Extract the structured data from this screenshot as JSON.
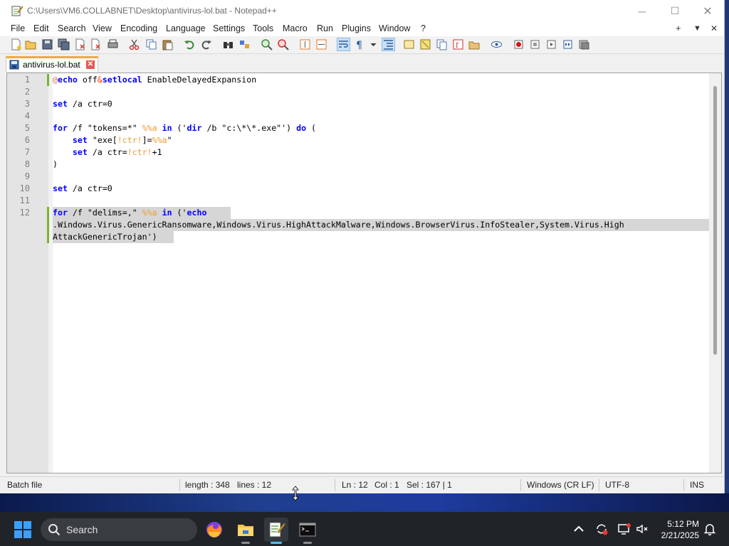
{
  "window": {
    "title": "C:\\Users\\VM6.COLLABNET\\Desktop\\antivirus-lol.bat - Notepad++",
    "minimize_icon": "minimize-icon",
    "maximize_icon": "maximize-icon",
    "close_icon": "close-icon"
  },
  "menu": {
    "items": [
      "File",
      "Edit",
      "Search",
      "View",
      "Encoding",
      "Language",
      "Settings",
      "Tools",
      "Macro",
      "Run",
      "Plugins",
      "Window",
      "?"
    ],
    "right": [
      "+",
      "▼",
      "✕"
    ]
  },
  "tab": {
    "label": "antivirus-lol.bat",
    "icon": "save-disk-icon",
    "close_icon": "tab-close-icon"
  },
  "editor": {
    "line_numbers": [
      "1",
      "2",
      "3",
      "4",
      "5",
      "6",
      "7",
      "8",
      "9",
      "10",
      "11",
      "12"
    ],
    "lines": [
      [
        {
          "t": "@",
          "c": "at"
        },
        {
          "t": "echo",
          "c": "kw"
        },
        {
          "t": " off",
          "c": "tx"
        },
        {
          "t": "&",
          "c": "amp"
        },
        {
          "t": "setlocal",
          "c": "kw"
        },
        {
          "t": " EnableDelayedExpansion",
          "c": "tx"
        }
      ],
      [],
      [
        {
          "t": "set",
          "c": "kw"
        },
        {
          "t": " /a ctr=0",
          "c": "tx"
        }
      ],
      [],
      [
        {
          "t": "for",
          "c": "kw"
        },
        {
          "t": " /f \"tokens=*\" ",
          "c": "tx"
        },
        {
          "t": "%%a",
          "c": "var"
        },
        {
          "t": " ",
          "c": "tx"
        },
        {
          "t": "in",
          "c": "kw"
        },
        {
          "t": " ('",
          "c": "tx"
        },
        {
          "t": "dir",
          "c": "kw"
        },
        {
          "t": " /b \"c:\\*\\*.exe\"') ",
          "c": "tx"
        },
        {
          "t": "do",
          "c": "kw"
        },
        {
          "t": " (",
          "c": "tx"
        }
      ],
      [
        {
          "t": "    ",
          "c": "tx"
        },
        {
          "t": "set",
          "c": "kw"
        },
        {
          "t": " \"exe[",
          "c": "tx"
        },
        {
          "t": "!ctr!",
          "c": "var"
        },
        {
          "t": "]=",
          "c": "tx"
        },
        {
          "t": "%%a",
          "c": "var"
        },
        {
          "t": "\"",
          "c": "tx"
        }
      ],
      [
        {
          "t": "    ",
          "c": "tx"
        },
        {
          "t": "set",
          "c": "kw"
        },
        {
          "t": " /a ctr=",
          "c": "tx"
        },
        {
          "t": "!ctr!",
          "c": "var"
        },
        {
          "t": "+1",
          "c": "tx"
        }
      ],
      [
        {
          "t": ")",
          "c": "tx"
        }
      ],
      [],
      [
        {
          "t": "set",
          "c": "kw"
        },
        {
          "t": " /a ctr=0",
          "c": "tx"
        }
      ],
      [],
      [
        {
          "t": "for",
          "c": "kw"
        },
        {
          "t": " /f \"delims=,\" ",
          "c": "tx"
        },
        {
          "t": "%%a",
          "c": "var"
        },
        {
          "t": " ",
          "c": "tx"
        },
        {
          "t": "in",
          "c": "kw"
        },
        {
          "t": " ('",
          "c": "tx"
        },
        {
          "t": "echo",
          "c": "kw"
        }
      ]
    ],
    "wrap_lines": [
      ".Windows.Virus.GenericRansomware,Windows.Virus.HighAttackMalware,Windows.BrowserVirus.InfoStealer,System.Virus.High",
      "AttackGenericTrojan')"
    ]
  },
  "status": {
    "file_type": "Batch file",
    "length": "length : 348",
    "lines": "lines : 12",
    "ln": "Ln : 12",
    "col": "Col : 1",
    "sel": "Sel : 167 | 1",
    "eol": "Windows (CR LF)",
    "encoding": "UTF-8",
    "mode": "INS"
  },
  "taskbar": {
    "search_label": "Search",
    "time": "5:12 PM",
    "date": "2/21/2025",
    "colors": {
      "taskbar_bg": "#202428",
      "accent": "#2b7de0"
    }
  }
}
